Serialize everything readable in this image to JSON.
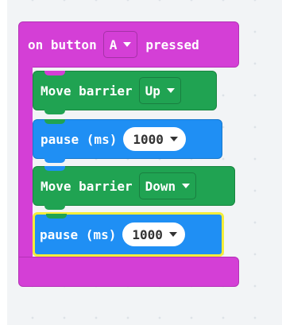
{
  "event_block": {
    "prefix": "on button",
    "button_value": "A",
    "suffix": "pressed",
    "color": "#d43fd6"
  },
  "statements": [
    {
      "label": "Move barrier",
      "value": "Up",
      "color": "#20a352"
    },
    {
      "label": "pause (ms)",
      "value": "1000",
      "color": "#1f8ff4"
    },
    {
      "label": "Move barrier",
      "value": "Down",
      "color": "#20a352"
    },
    {
      "label": "pause (ms)",
      "value": "1000",
      "color": "#1f8ff4",
      "selected": true
    }
  ],
  "icons": {
    "dropdown": "chevron-down-icon"
  },
  "colors": {
    "selection_outline": "#f4ed3a",
    "workspace_background": "#f2f4f6"
  }
}
